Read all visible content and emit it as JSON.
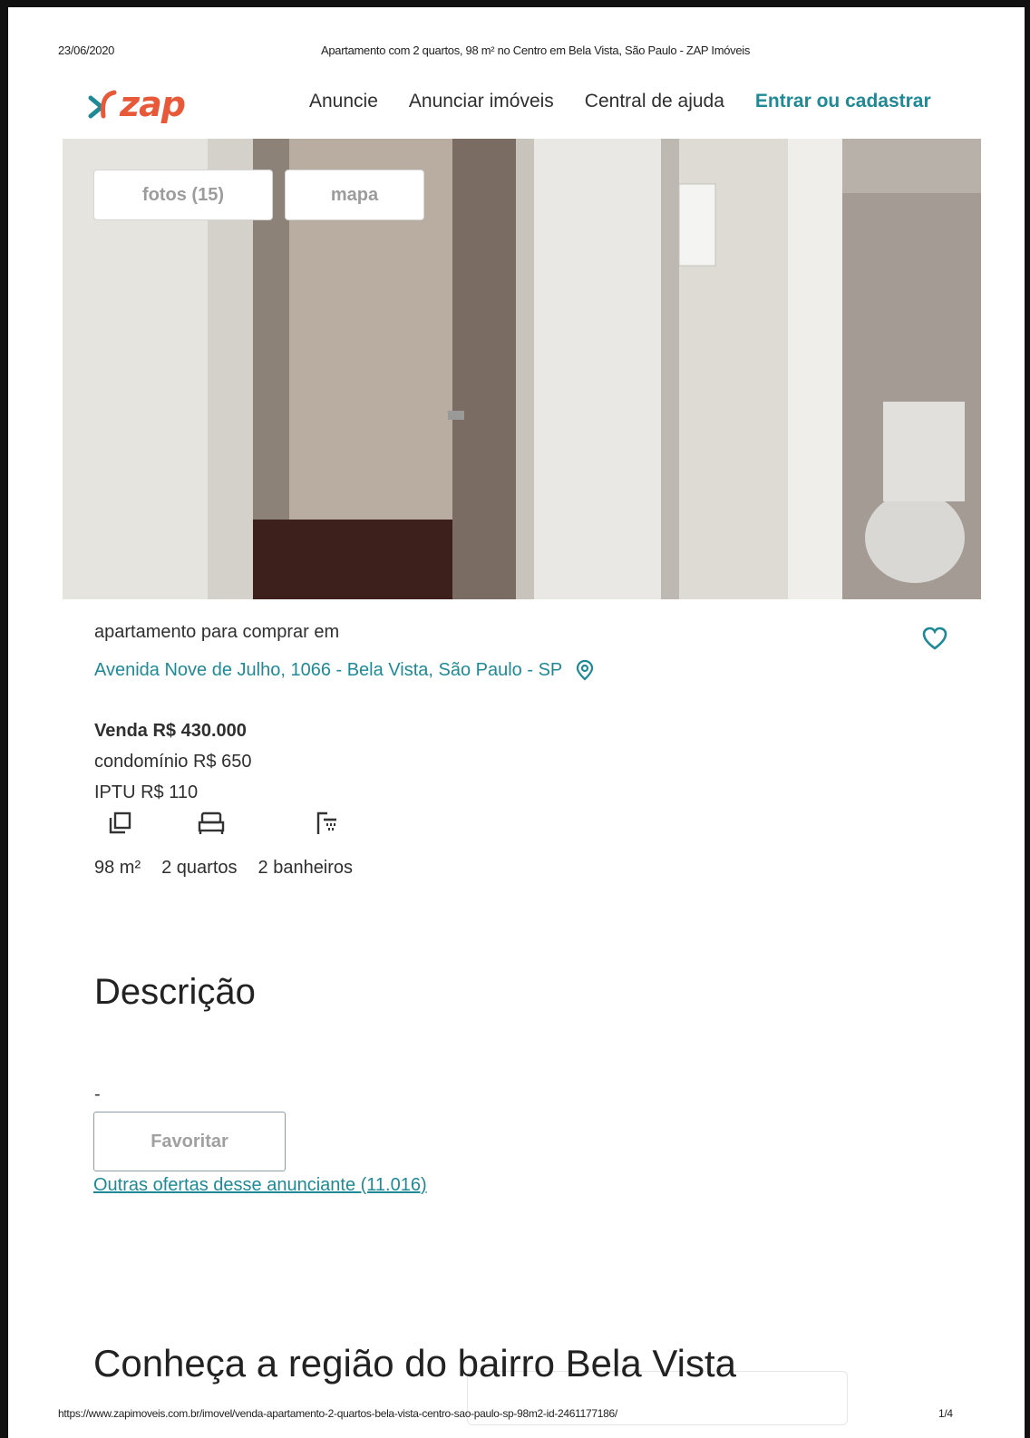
{
  "print_header": {
    "date": "23/06/2020",
    "title": "Apartamento com 2 quartos, 98 m² no Centro em Bela Vista, São Paulo - ZAP Imóveis"
  },
  "logo": {
    "text": "zap",
    "icon": "zap-logo-icon",
    "color": "#e8593a",
    "icon_color": "#1f8a96"
  },
  "nav": {
    "items": [
      "Anuncie",
      "Anunciar imóveis",
      "Central de ajuda"
    ],
    "login": "Entrar ou cadastrar"
  },
  "gallery": {
    "fotos_label": "fotos (15)",
    "mapa_label": "mapa"
  },
  "listing": {
    "kicker": "apartamento para comprar em",
    "address": "Avenida Nove de Julho, 1066 - Bela Vista, São Paulo - SP",
    "sale": "Venda R$ 430.000",
    "condo": "condomínio R$ 650",
    "iptu": "IPTU R$ 110",
    "area": "98 m²",
    "bedrooms": "2 quartos",
    "bathrooms": "2 banheiros"
  },
  "description": {
    "heading": "Descrição",
    "text": "-",
    "favorite_label": "Favoritar",
    "other_offers": "Outras ofertas desse anunciante (11.016)"
  },
  "region": {
    "heading": "Conheça a região do bairro Bela Vista"
  },
  "print_footer": {
    "url": "https://www.zapimoveis.com.br/imovel/venda-apartamento-2-quartos-bela-vista-centro-sao-paulo-sp-98m2-id-2461177186/",
    "page": "1/4"
  },
  "colors": {
    "accent": "#1f8a96",
    "brand": "#e8593a"
  }
}
